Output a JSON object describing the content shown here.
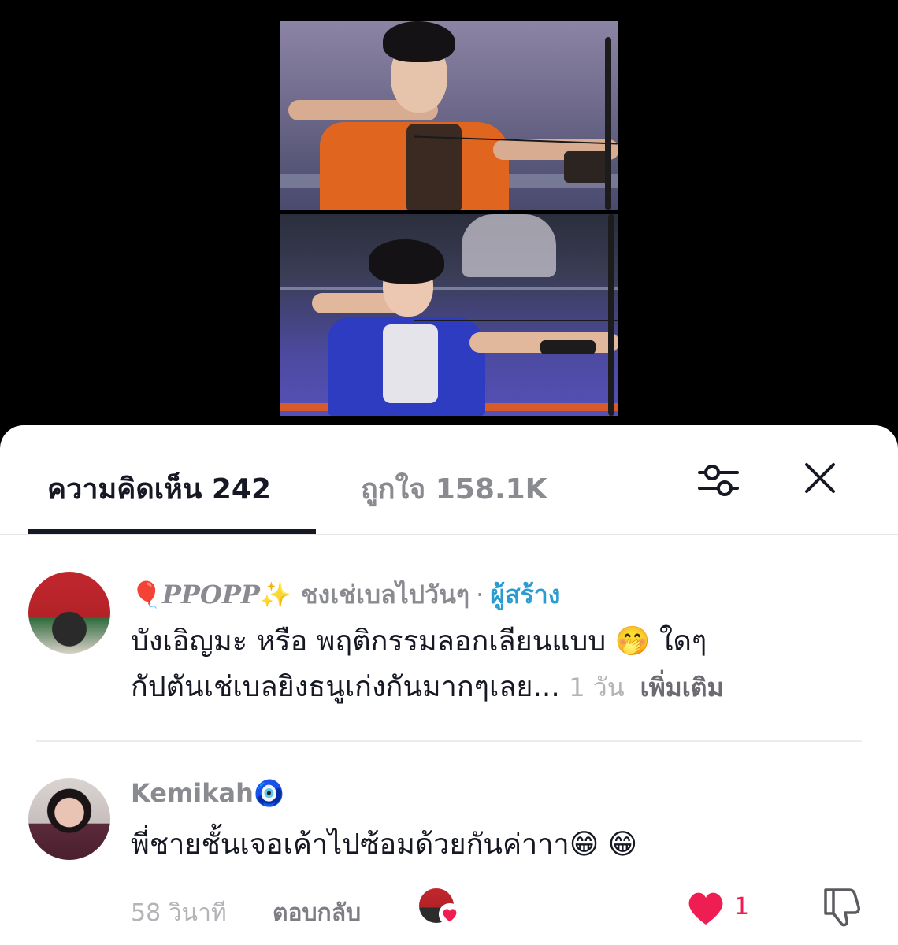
{
  "tabs": {
    "comments": "ความคิดเห็น 242",
    "likes": "ถูกใจ 158.1K"
  },
  "icons": {
    "filter": "sliders-icon",
    "close": "close-icon",
    "like": "heart-icon",
    "dislike": "thumbs-down-icon"
  },
  "colors": {
    "accent_like": "#ee1d52",
    "creator_badge": "#2a9dd0",
    "text_primary": "#161823",
    "text_secondary": "#8a8b91"
  },
  "comments": [
    {
      "username": "PPOPP",
      "username_prefix_emoji": "🎈",
      "username_suffix_emoji": "✨",
      "subtitle": "ชงเช่เบลไปวันๆ",
      "separator": "·",
      "badge": "ผู้สร้าง",
      "text_line1": "บังเอิญมะ หรือ พฤติกรรมลอกเลียนแบบ",
      "text_line1_emoji": "🤭",
      "text_line1_tail": " ใดๆ",
      "text_line2": "กัปตันเช่เบลยิงธนูเก่งกันมากๆเลย...",
      "time": "1 วัน",
      "more": "เพิ่มเติม"
    },
    {
      "username": "Kemikah",
      "username_suffix_emoji": "🧿",
      "text": "พี่ชายชั้นเจอเค้าไปซ้อมด้วยกันค่าาา",
      "text_emojis": "😁 😁",
      "time": "58 วินาที",
      "reply": "ตอบกลับ",
      "like_count": "1"
    }
  ]
}
